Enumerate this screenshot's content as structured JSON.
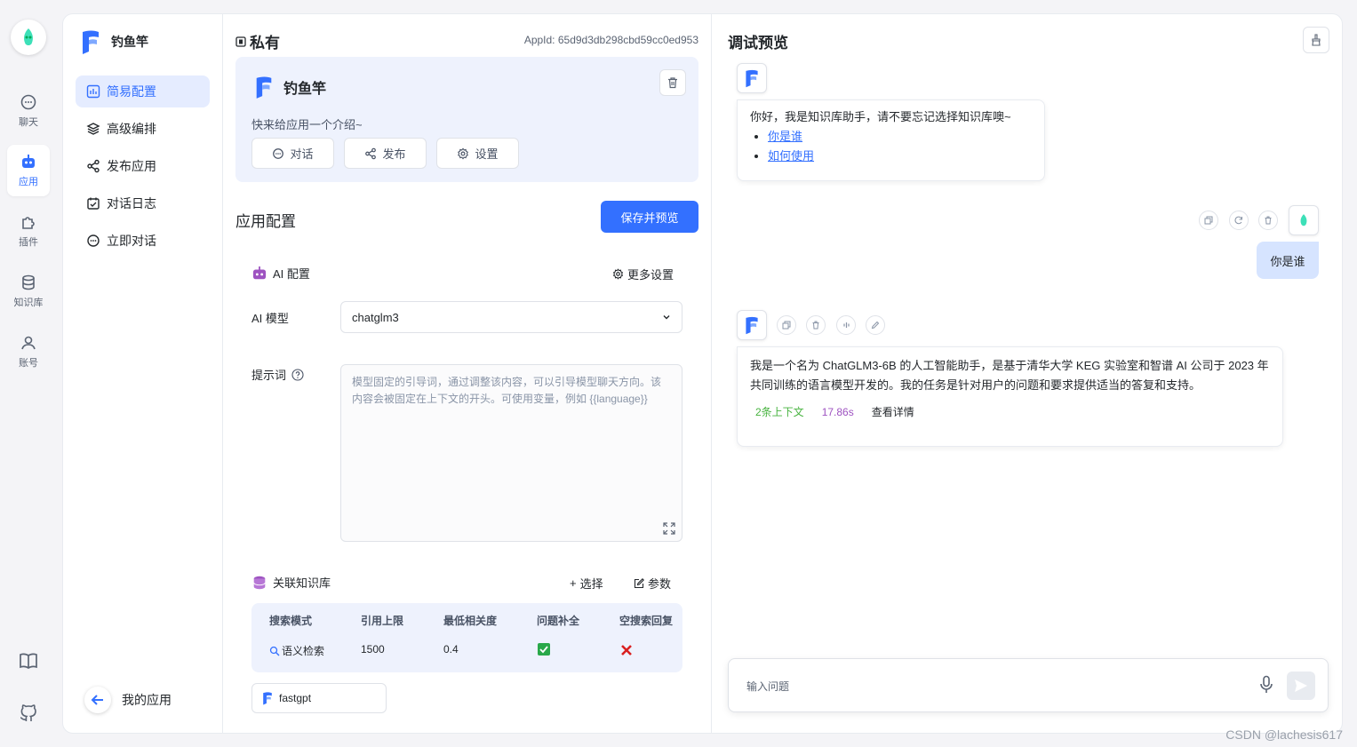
{
  "rail": {
    "items": [
      {
        "label": "聊天",
        "icon": "chat-icon"
      },
      {
        "label": "应用",
        "icon": "robot-icon"
      },
      {
        "label": "插件",
        "icon": "puzzle-icon"
      },
      {
        "label": "知识库",
        "icon": "database-icon"
      },
      {
        "label": "账号",
        "icon": "user-icon"
      }
    ],
    "bottom_icons": [
      "book-icon",
      "github-icon"
    ]
  },
  "appnav": {
    "app_name": "钓鱼竿",
    "items": [
      {
        "label": "简易配置",
        "icon": "chart-icon"
      },
      {
        "label": "高级编排",
        "icon": "layers-icon"
      },
      {
        "label": "发布应用",
        "icon": "share-icon"
      },
      {
        "label": "对话日志",
        "icon": "calendar-icon"
      },
      {
        "label": "立即对话",
        "icon": "chat-icon"
      }
    ],
    "back_label": "我的应用"
  },
  "config": {
    "title": "私有",
    "appid": "AppId: 65d9d3db298cbd59cc0ed953",
    "app_name": "钓鱼竿",
    "intro": "快来给应用一个介绍~",
    "buttons": [
      "对话",
      "发布",
      "设置"
    ],
    "section_title": "应用配置",
    "save_label": "保存并预览",
    "ai_config_label": "AI 配置",
    "more_settings": "更多设置",
    "model_label": "AI 模型",
    "model_value": "chatglm3",
    "prompt_label": "提示词",
    "prompt_placeholder": "模型固定的引导词，通过调整该内容，可以引导模型聊天方向。该内容会被固定在上下文的开头。可使用变量，例如 {{language}}",
    "kb_label": "关联知识库",
    "kb_select": "选择",
    "kb_params": "参数",
    "kb_table": {
      "headers": [
        "搜索模式",
        "引用上限",
        "最低相关度",
        "问题补全",
        "空搜索回复"
      ],
      "values": {
        "mode": "语义检索",
        "limit": "1500",
        "min_relevance": "0.4"
      },
      "completion_on": true,
      "empty_reply_on": false
    },
    "kb_chip": "fastgpt"
  },
  "preview": {
    "title": "调试预览",
    "welcome": "你好，我是知识库助手，请不要忘记选择知识库噢~",
    "welcome_links": [
      "你是谁",
      "如何使用"
    ],
    "user_msg": "你是谁",
    "bot_reply": "我是一个名为 ChatGLM3-6B 的人工智能助手，是基于清华大学 KEG 实验室和智谱 AI 公司于 2023 年共同训练的语言模型开发的。我的任务是针对用户的问题和要求提供适当的答复和支持。",
    "meta": {
      "context": "2条上下文",
      "time": "17.86s",
      "details": "查看详情"
    },
    "input_placeholder": "输入问题"
  },
  "watermark": "CSDN @lachesis617",
  "colors": {
    "accent": "#3370ff",
    "green": "#47b33f",
    "purple": "#9e53c1"
  }
}
